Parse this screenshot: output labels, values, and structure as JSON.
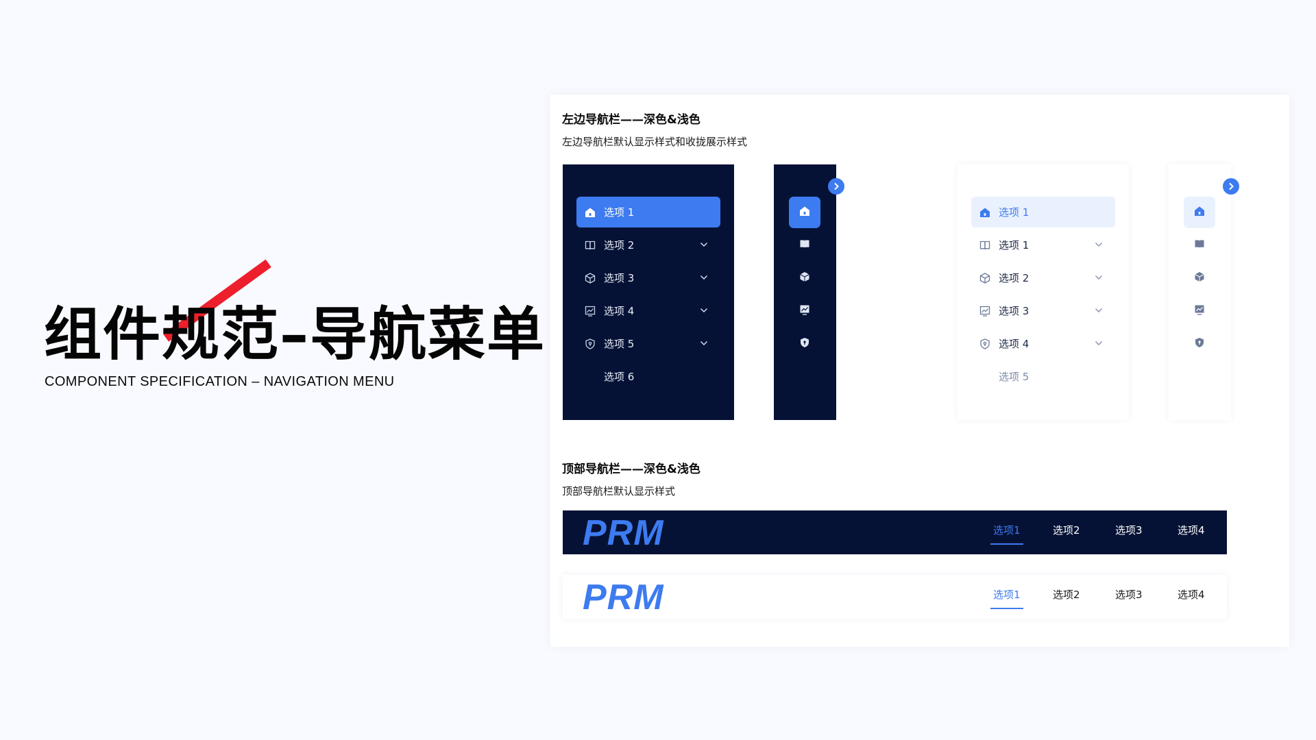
{
  "hero": {
    "title": "组件规范–导航菜单",
    "subtitle": "COMPONENT SPECIFICATION – NAVIGATION MENU"
  },
  "colors": {
    "accent": "#3d7bf0",
    "dark_nav": "#061235",
    "light_active_bg": "#eaf1fe",
    "slash": "#ee1f2c"
  },
  "left_section": {
    "title": "左边导航栏——深色&浅色",
    "desc": "左边导航栏默认显示样式和收拢展示样式"
  },
  "dark_sidenav": {
    "items": [
      {
        "label": "选项 1",
        "icon": "home-icon",
        "active": true
      },
      {
        "label": "选项 2",
        "icon": "book-icon",
        "expandable": true
      },
      {
        "label": "选项 3",
        "icon": "box-icon",
        "expandable": true
      },
      {
        "label": "选项 4",
        "icon": "chart-icon",
        "expandable": true
      },
      {
        "label": "选项 5",
        "icon": "shield-icon",
        "expandable": true
      },
      {
        "label": "选项 6"
      }
    ]
  },
  "light_sidenav": {
    "items": [
      {
        "label": "选项 1",
        "icon": "home-icon",
        "active": true
      },
      {
        "label": "选项 1",
        "icon": "book-icon",
        "expandable": true
      },
      {
        "label": "选项 2",
        "icon": "box-icon",
        "expandable": true
      },
      {
        "label": "选项 3",
        "icon": "chart-icon",
        "expandable": true
      },
      {
        "label": "选项 4",
        "icon": "shield-icon",
        "expandable": true
      },
      {
        "label": "选项 5"
      }
    ]
  },
  "top_section": {
    "title": "顶部导航栏——深色&浅色",
    "desc": "顶部导航栏默认显示样式"
  },
  "topnav": {
    "logo": "PRM",
    "items": [
      "选项1",
      "选项2",
      "选项3",
      "选项4"
    ],
    "active_index": 0
  }
}
